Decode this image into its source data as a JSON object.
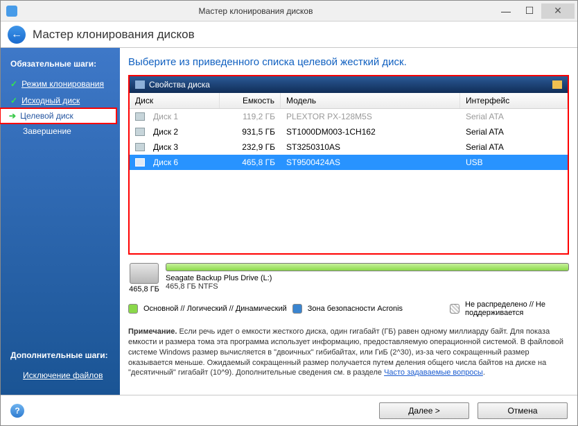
{
  "titlebar": {
    "title": "Мастер клонирования дисков"
  },
  "header": {
    "title": "Мастер клонирования дисков"
  },
  "sidebar": {
    "mandatory_label": "Обязательные шаги:",
    "items": [
      {
        "label": "Режим клонирования"
      },
      {
        "label": "Исходный диск"
      },
      {
        "label": "Целевой диск"
      },
      {
        "label": "Завершение"
      }
    ],
    "additional_label": "Дополнительные шаги:",
    "additional_items": [
      {
        "label": "Исключение файлов"
      }
    ]
  },
  "main": {
    "title": "Выберите из приведенного списка целевой жесткий диск.",
    "panel_header": "Свойства диска",
    "columns": {
      "disk": "Диск",
      "capacity": "Емкость",
      "model": "Модель",
      "interface": "Интерфейс"
    },
    "rows": [
      {
        "name": "Диск 1",
        "capacity": "119,2 ГБ",
        "model": "PLEXTOR PX-128M5S",
        "interface": "Serial ATA",
        "dim": true
      },
      {
        "name": "Диск 2",
        "capacity": "931,5 ГБ",
        "model": "ST1000DM003-1CH162",
        "interface": "Serial ATA"
      },
      {
        "name": "Диск 3",
        "capacity": "232,9 ГБ",
        "model": "ST3250310AS",
        "interface": "Serial ATA"
      },
      {
        "name": "Диск 6",
        "capacity": "465,8 ГБ",
        "model": "ST9500424AS",
        "interface": "USB",
        "selected": true
      }
    ]
  },
  "summary": {
    "total": "465,8 ГБ",
    "name": "Seagate Backup Plus Drive (L:)",
    "details": "465,8 ГБ  NTFS"
  },
  "legend": {
    "primary": "Основной // Логический // Динамический",
    "zone": "Зона безопасности Acronis",
    "unalloc": "Не распределено // Не поддерживается"
  },
  "note": {
    "bold": "Примечание.",
    "body": " Если речь идет о емкости жесткого диска, один гигабайт (ГБ) равен одному миллиарду байт. Для показа емкости и размера тома эта программа использует информацию, предоставляемую операционной системой. В файловой системе Windows размер вычисляется в \"двоичных\" гибибайтах, или ГиБ (2^30), из-за чего сокращенный размер оказывается меньше. Ожидаемый сокращенный размер получается путем деления общего числа байтов на диске на \"десятичный\" гигабайт (10^9). Дополнительные сведения см. в разделе ",
    "link": "Часто задаваемые вопросы",
    "tail": "."
  },
  "footer": {
    "next": "Далее >",
    "cancel": "Отмена"
  }
}
